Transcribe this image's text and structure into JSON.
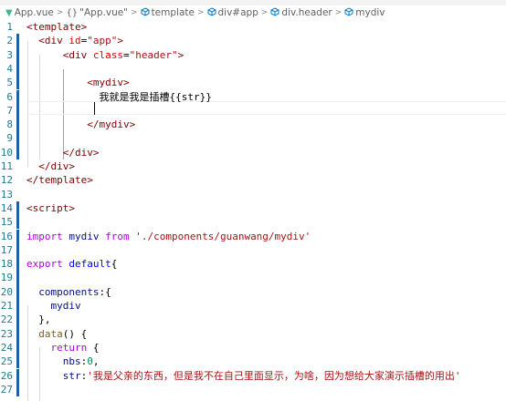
{
  "breadcrumb": {
    "items": [
      {
        "icon": "vue-logo-icon",
        "label": "App.vue"
      },
      {
        "icon": "braces-icon",
        "label": "\"App.vue\""
      },
      {
        "icon": "element-node-icon",
        "label": "template"
      },
      {
        "icon": "element-node-icon",
        "label": "div#app"
      },
      {
        "icon": "element-node-icon",
        "label": "div.header"
      },
      {
        "icon": "element-node-icon",
        "label": "mydiv"
      }
    ],
    "separator": ">",
    "braces_glyph": "{}"
  },
  "editor": {
    "lines": [
      {
        "n": "1",
        "segs": [
          [
            "tag",
            "<template>"
          ]
        ]
      },
      {
        "n": "2",
        "segs": [
          [
            "plain",
            "  "
          ],
          [
            "tag",
            "<div "
          ],
          [
            "attr",
            "id"
          ],
          [
            "plain",
            "="
          ],
          [
            "str",
            "\"app\""
          ],
          [
            "tag",
            ">"
          ]
        ]
      },
      {
        "n": "3",
        "segs": [
          [
            "plain",
            "      "
          ],
          [
            "tag",
            "<div "
          ],
          [
            "attr",
            "class"
          ],
          [
            "plain",
            "="
          ],
          [
            "str",
            "\"header\""
          ],
          [
            "tag",
            ">"
          ]
        ]
      },
      {
        "n": "4",
        "segs": []
      },
      {
        "n": "5",
        "segs": [
          [
            "plain",
            "          "
          ],
          [
            "tag",
            "<mydiv>"
          ]
        ]
      },
      {
        "n": "6",
        "segs": [
          [
            "plain",
            "            "
          ],
          [
            "cjk",
            "我就是我是插槽"
          ],
          [
            "plain",
            "{{str}}"
          ]
        ]
      },
      {
        "n": "7",
        "segs": []
      },
      {
        "n": "8",
        "segs": [
          [
            "plain",
            "          "
          ],
          [
            "tag",
            "</mydiv>"
          ]
        ]
      },
      {
        "n": "9",
        "segs": []
      },
      {
        "n": "10",
        "segs": [
          [
            "plain",
            "      "
          ],
          [
            "tag",
            "</div>"
          ]
        ]
      },
      {
        "n": "11",
        "segs": [
          [
            "plain",
            "  "
          ],
          [
            "tag",
            "</div>"
          ]
        ]
      },
      {
        "n": "12",
        "segs": [
          [
            "tag",
            "</template>"
          ]
        ]
      },
      {
        "n": "13",
        "segs": []
      },
      {
        "n": "14",
        "segs": [
          [
            "tag",
            "<script>"
          ]
        ]
      },
      {
        "n": "15",
        "segs": []
      },
      {
        "n": "16",
        "segs": [
          [
            "kw2",
            "import "
          ],
          [
            "prop",
            "mydiv "
          ],
          [
            "kw2",
            "from "
          ],
          [
            "str",
            "'./components/guanwang/mydiv'"
          ]
        ]
      },
      {
        "n": "17",
        "segs": []
      },
      {
        "n": "18",
        "segs": [
          [
            "kw2",
            "export "
          ],
          [
            "kw",
            "default"
          ],
          [
            "plain",
            "{"
          ]
        ]
      },
      {
        "n": "19",
        "segs": []
      },
      {
        "n": "20",
        "segs": [
          [
            "plain",
            "  "
          ],
          [
            "prop",
            "components"
          ],
          [
            "plain",
            ":{"
          ]
        ]
      },
      {
        "n": "21",
        "segs": [
          [
            "plain",
            "    "
          ],
          [
            "prop",
            "mydiv"
          ]
        ]
      },
      {
        "n": "22",
        "segs": [
          [
            "plain",
            "  },"
          ]
        ]
      },
      {
        "n": "23",
        "segs": [
          [
            "plain",
            "  "
          ],
          [
            "fn",
            "data"
          ],
          [
            "plain",
            "() {"
          ]
        ]
      },
      {
        "n": "24",
        "segs": [
          [
            "plain",
            "    "
          ],
          [
            "kw2",
            "return "
          ],
          [
            "plain",
            "{"
          ]
        ]
      },
      {
        "n": "25",
        "segs": [
          [
            "plain",
            "      "
          ],
          [
            "prop",
            "nbs"
          ],
          [
            "plain",
            ":"
          ],
          [
            "num",
            "0"
          ],
          [
            "plain",
            ","
          ]
        ]
      },
      {
        "n": "26",
        "segs": [
          [
            "plain",
            "      "
          ],
          [
            "prop",
            "str"
          ],
          [
            "plain",
            ":"
          ],
          [
            "str",
            "'"
          ],
          [
            "strcjk",
            "我是父亲的东西，但是我不在自己里面显示，为啥，因为想给大家演示插槽的用出"
          ],
          [
            "str",
            "'"
          ]
        ]
      },
      {
        "n": "27",
        "segs": []
      }
    ]
  }
}
